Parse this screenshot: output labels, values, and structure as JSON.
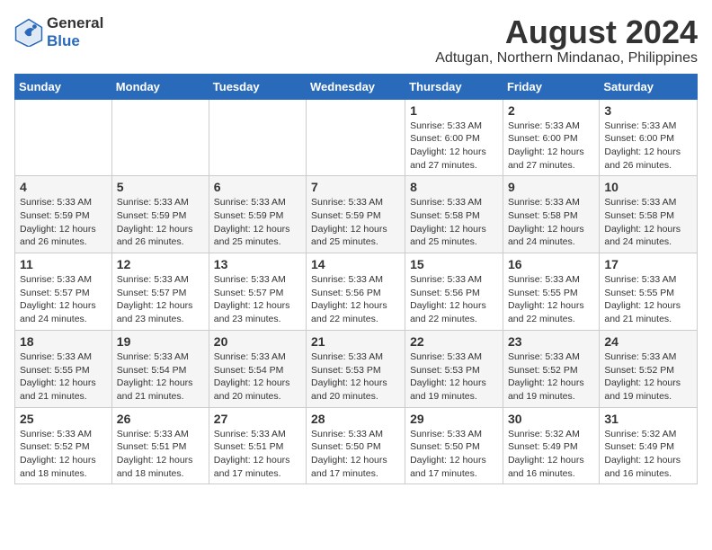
{
  "header": {
    "logo_general": "General",
    "logo_blue": "Blue",
    "month_year": "August 2024",
    "location": "Adtugan, Northern Mindanao, Philippines"
  },
  "weekdays": [
    "Sunday",
    "Monday",
    "Tuesday",
    "Wednesday",
    "Thursday",
    "Friday",
    "Saturday"
  ],
  "weeks": [
    [
      {
        "day": "",
        "info": ""
      },
      {
        "day": "",
        "info": ""
      },
      {
        "day": "",
        "info": ""
      },
      {
        "day": "",
        "info": ""
      },
      {
        "day": "1",
        "info": "Sunrise: 5:33 AM\nSunset: 6:00 PM\nDaylight: 12 hours\nand 27 minutes."
      },
      {
        "day": "2",
        "info": "Sunrise: 5:33 AM\nSunset: 6:00 PM\nDaylight: 12 hours\nand 27 minutes."
      },
      {
        "day": "3",
        "info": "Sunrise: 5:33 AM\nSunset: 6:00 PM\nDaylight: 12 hours\nand 26 minutes."
      }
    ],
    [
      {
        "day": "4",
        "info": "Sunrise: 5:33 AM\nSunset: 5:59 PM\nDaylight: 12 hours\nand 26 minutes."
      },
      {
        "day": "5",
        "info": "Sunrise: 5:33 AM\nSunset: 5:59 PM\nDaylight: 12 hours\nand 26 minutes."
      },
      {
        "day": "6",
        "info": "Sunrise: 5:33 AM\nSunset: 5:59 PM\nDaylight: 12 hours\nand 25 minutes."
      },
      {
        "day": "7",
        "info": "Sunrise: 5:33 AM\nSunset: 5:59 PM\nDaylight: 12 hours\nand 25 minutes."
      },
      {
        "day": "8",
        "info": "Sunrise: 5:33 AM\nSunset: 5:58 PM\nDaylight: 12 hours\nand 25 minutes."
      },
      {
        "day": "9",
        "info": "Sunrise: 5:33 AM\nSunset: 5:58 PM\nDaylight: 12 hours\nand 24 minutes."
      },
      {
        "day": "10",
        "info": "Sunrise: 5:33 AM\nSunset: 5:58 PM\nDaylight: 12 hours\nand 24 minutes."
      }
    ],
    [
      {
        "day": "11",
        "info": "Sunrise: 5:33 AM\nSunset: 5:57 PM\nDaylight: 12 hours\nand 24 minutes."
      },
      {
        "day": "12",
        "info": "Sunrise: 5:33 AM\nSunset: 5:57 PM\nDaylight: 12 hours\nand 23 minutes."
      },
      {
        "day": "13",
        "info": "Sunrise: 5:33 AM\nSunset: 5:57 PM\nDaylight: 12 hours\nand 23 minutes."
      },
      {
        "day": "14",
        "info": "Sunrise: 5:33 AM\nSunset: 5:56 PM\nDaylight: 12 hours\nand 22 minutes."
      },
      {
        "day": "15",
        "info": "Sunrise: 5:33 AM\nSunset: 5:56 PM\nDaylight: 12 hours\nand 22 minutes."
      },
      {
        "day": "16",
        "info": "Sunrise: 5:33 AM\nSunset: 5:55 PM\nDaylight: 12 hours\nand 22 minutes."
      },
      {
        "day": "17",
        "info": "Sunrise: 5:33 AM\nSunset: 5:55 PM\nDaylight: 12 hours\nand 21 minutes."
      }
    ],
    [
      {
        "day": "18",
        "info": "Sunrise: 5:33 AM\nSunset: 5:55 PM\nDaylight: 12 hours\nand 21 minutes."
      },
      {
        "day": "19",
        "info": "Sunrise: 5:33 AM\nSunset: 5:54 PM\nDaylight: 12 hours\nand 21 minutes."
      },
      {
        "day": "20",
        "info": "Sunrise: 5:33 AM\nSunset: 5:54 PM\nDaylight: 12 hours\nand 20 minutes."
      },
      {
        "day": "21",
        "info": "Sunrise: 5:33 AM\nSunset: 5:53 PM\nDaylight: 12 hours\nand 20 minutes."
      },
      {
        "day": "22",
        "info": "Sunrise: 5:33 AM\nSunset: 5:53 PM\nDaylight: 12 hours\nand 19 minutes."
      },
      {
        "day": "23",
        "info": "Sunrise: 5:33 AM\nSunset: 5:52 PM\nDaylight: 12 hours\nand 19 minutes."
      },
      {
        "day": "24",
        "info": "Sunrise: 5:33 AM\nSunset: 5:52 PM\nDaylight: 12 hours\nand 19 minutes."
      }
    ],
    [
      {
        "day": "25",
        "info": "Sunrise: 5:33 AM\nSunset: 5:52 PM\nDaylight: 12 hours\nand 18 minutes."
      },
      {
        "day": "26",
        "info": "Sunrise: 5:33 AM\nSunset: 5:51 PM\nDaylight: 12 hours\nand 18 minutes."
      },
      {
        "day": "27",
        "info": "Sunrise: 5:33 AM\nSunset: 5:51 PM\nDaylight: 12 hours\nand 17 minutes."
      },
      {
        "day": "28",
        "info": "Sunrise: 5:33 AM\nSunset: 5:50 PM\nDaylight: 12 hours\nand 17 minutes."
      },
      {
        "day": "29",
        "info": "Sunrise: 5:33 AM\nSunset: 5:50 PM\nDaylight: 12 hours\nand 17 minutes."
      },
      {
        "day": "30",
        "info": "Sunrise: 5:32 AM\nSunset: 5:49 PM\nDaylight: 12 hours\nand 16 minutes."
      },
      {
        "day": "31",
        "info": "Sunrise: 5:32 AM\nSunset: 5:49 PM\nDaylight: 12 hours\nand 16 minutes."
      }
    ]
  ]
}
